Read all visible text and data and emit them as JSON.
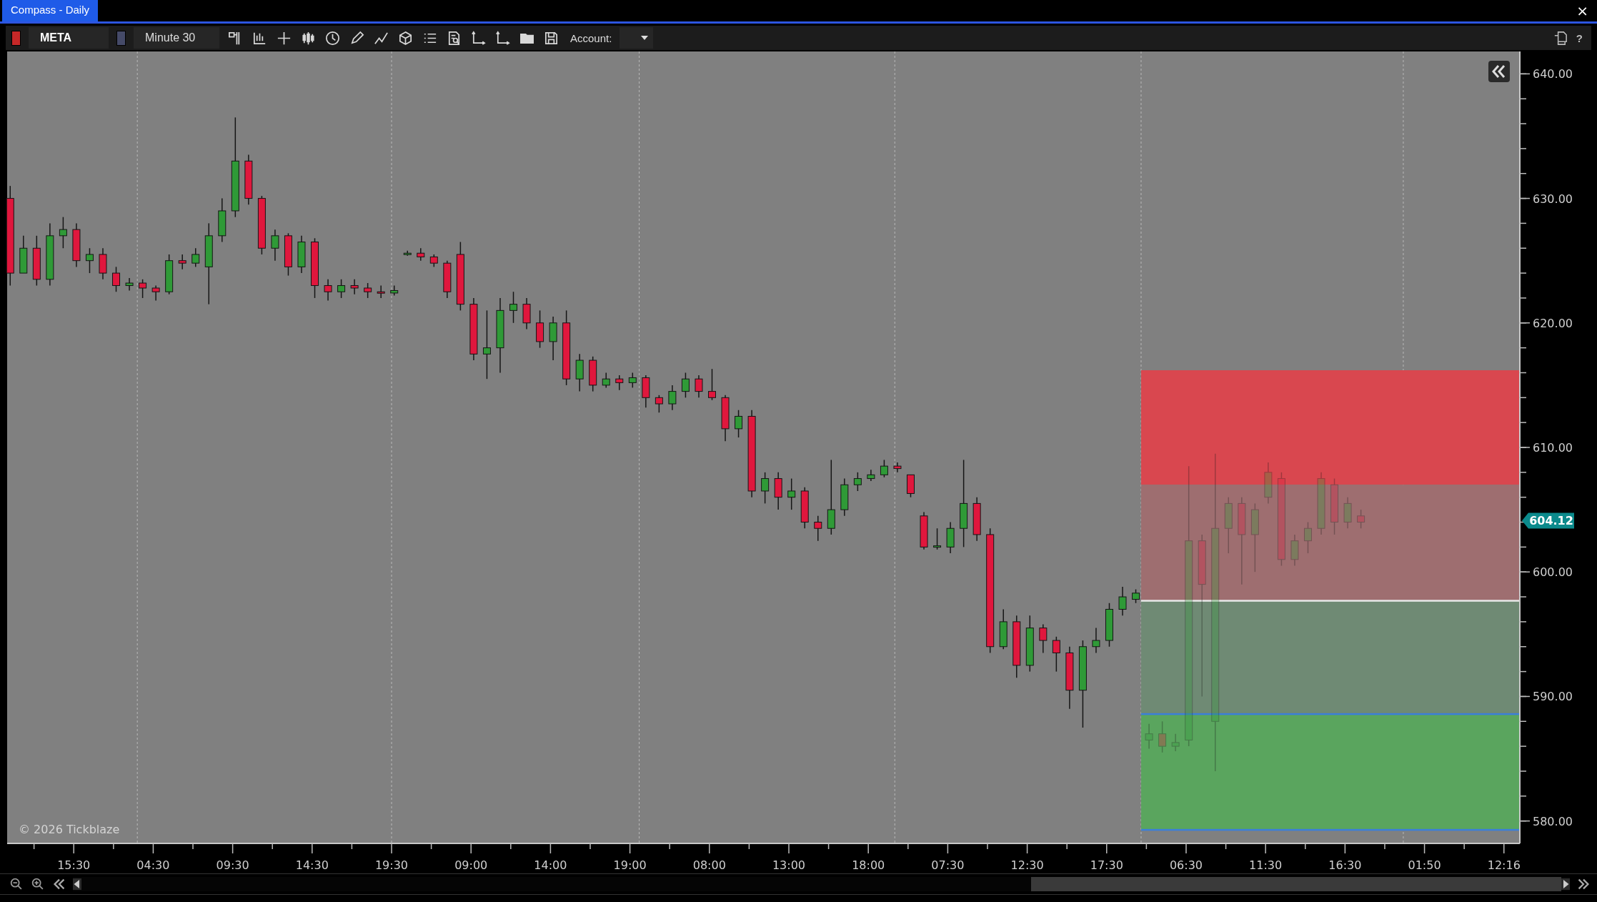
{
  "window": {
    "title": "Compass - Daily",
    "close": "×"
  },
  "toolbar": {
    "symbol": {
      "text": "META",
      "color": "#c62828"
    },
    "timeframe": {
      "text": "Minute 30",
      "color": "#454a68"
    },
    "account_label": "Account:",
    "help": "?"
  },
  "chart": {
    "copyright": "© 2026 Tickblaze",
    "price_axis": [
      "640.00",
      "630.00",
      "620.00",
      "610.00",
      "600.00",
      "590.00",
      "580.00"
    ],
    "time_axis": [
      "15:30",
      "04:30",
      "09:30",
      "14:30",
      "19:30",
      "09:00",
      "14:00",
      "19:00",
      "08:00",
      "13:00",
      "18:00",
      "07:30",
      "12:30",
      "17:30",
      "06:30",
      "11:30",
      "16:30",
      "01:50",
      "12:16"
    ],
    "zones": [
      {
        "color": "#d9474f"
      },
      {
        "color": "#9e6e70"
      },
      {
        "color": "#6f8a74"
      },
      {
        "color": "#5aa55e"
      }
    ],
    "level_lines": [
      {
        "color": "#e8e8e8"
      },
      {
        "color": "#3b7fd9"
      },
      {
        "color": "#3b7fd9"
      }
    ],
    "price_marker": {
      "label": "604.12",
      "color": "#0b8a8c"
    }
  }
}
